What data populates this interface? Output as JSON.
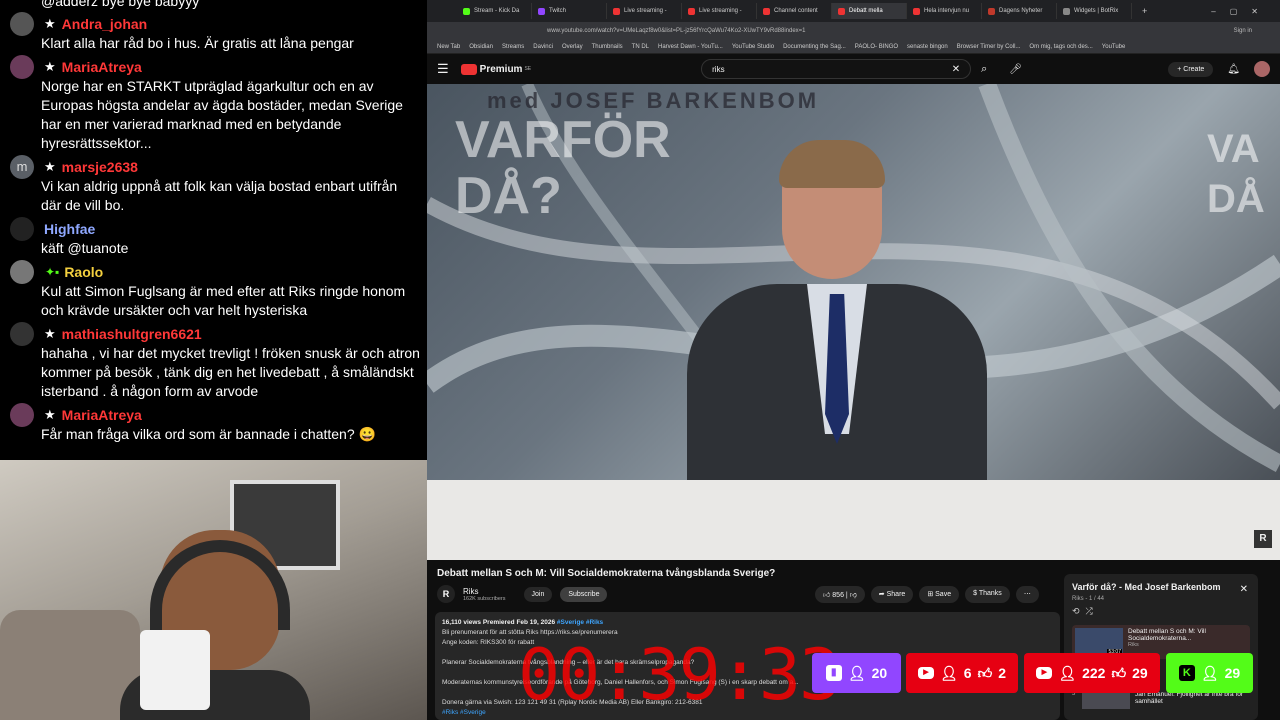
{
  "chat": {
    "messages": [
      {
        "user": "",
        "text": "@adderz bye bye babyyy"
      },
      {
        "user": "Andra_johan",
        "text": "Klart alla har råd bo i hus. Är gratis att låna pengar"
      },
      {
        "user": "MariaAtreya",
        "text": "Norge har en STARKT utpräglad ägarkultur och en av Europas högsta andelar av ägda bostäder, medan Sverige har en mer varierad marknad med en betydande hyresrättssektor..."
      },
      {
        "user": "marsje2638",
        "avatar_letter": "m",
        "text": "Vi kan aldrig uppnå att folk kan välja bostad enbart utifrån där de vill bo."
      },
      {
        "user": "Highfae",
        "text": "käft @tuanote"
      },
      {
        "user": "Raolo",
        "text": "Kul att Simon Fuglsang är med efter att Riks ringde honom och krävde ursäkter och var helt hysteriska"
      },
      {
        "user": "mathiashultgren6621",
        "text": "hahaha , vi har det mycket trevligt ! fröken snusk är och atron kommer på besök , tänk dig en het livedebatt , å småländskt isterband . å någon form av arvode"
      },
      {
        "user": "MariaAtreya",
        "text": "Får man fråga vilka ord som är bannade i chatten? 😀"
      }
    ]
  },
  "browser": {
    "tabs": [
      "Stream - Kick Da",
      "Twitch",
      "Live streaming -",
      "Live streaming -",
      "Channel content",
      "Debatt mella",
      "Hela intervjun nu",
      "Dagens Nyheter",
      "Widgets | BotRix"
    ],
    "url": "www.youtube.com/watch?v=UMeLaqzf8w0&list=PL-jz56fYrcQaWu74Ko2-XUwTY9vRd88index=1",
    "sign_in": "Sign in",
    "bookmarks": [
      "New Tab",
      "Obsidian",
      "Streams",
      "Davinci",
      "Overlay",
      "Thumbnails",
      "TN DL",
      "Harvest Dawn - YouTu...",
      "YouTube Studio",
      "Documenting the Sag...",
      "PAOLO- BINGO",
      "senaste bingon",
      "Browser Timer by Coll...",
      "Om mig, tags och des...",
      "YouTube"
    ]
  },
  "youtube": {
    "logo": "Premium",
    "logo_sup": "SE",
    "search_value": "riks",
    "create_label": "Create",
    "video_overlay_text": "med JOSEF BARKENBOM",
    "video_big_text": "VARFÖR DÅ?",
    "video_big_text_right": "VA DÅ",
    "title": "Debatt mellan S och M: Vill Socialdemokraterna tvångsblanda Sverige?",
    "channel_name": "Riks",
    "subscribers": "162K subscribers",
    "join_label": "Join",
    "subscribe_label": "Subscribe",
    "likes": "856",
    "share_label": "Share",
    "save_label": "Save",
    "thanks_label": "Thanks",
    "description": {
      "meta": "16,110 views  Premiered Feb 19, 2026",
      "hashtags": "#Sverige #Riks",
      "line1": "Bli prenumerant för att stötta Riks https://riks.se/prenumerera",
      "line2": "Ange koden: RIKS300 för rabatt",
      "line3": "Planerar Socialdemokraterna tvångsblandning – eller är det bara skrämselpropaganda?",
      "line4": "Moderaternas kommunstyrelseordförande på Göteborg, Daniel Hallenfors, och Simon Fuglsang (S) i en skarp debatt om a...",
      "line5": "Donera gärna via Swish: 123 121 49 31 (Rplay Nordic Media AB) Eller Bankgiro: 212-6381",
      "line6": "#Riks #Sverige"
    },
    "playlist": {
      "title": "Varför då? - Med Josef Barkenbom",
      "meta": "Riks - 1 / 44",
      "items": [
        {
          "title": "Debatt mellan S och M: Vill Socialdemokraterna...",
          "channel": "Riks",
          "duration": "53:07"
        },
        {
          "title": "Jan Emanuel: Fjollighet är inte bra för samhället",
          "channel": "Riks",
          "index": "3"
        }
      ]
    }
  },
  "overlay": {
    "timer": "00:39:33",
    "stats": [
      {
        "platform": "twitch",
        "viewers": "20",
        "likes": ""
      },
      {
        "platform": "youtube",
        "viewers": "6",
        "likes": "2"
      },
      {
        "platform": "youtube",
        "viewers": "222",
        "likes": "29"
      },
      {
        "platform": "kick",
        "viewers": "29",
        "likes": ""
      }
    ]
  },
  "colors": {
    "twitch": "#9146ff",
    "youtube": "#e60012",
    "kick": "#53fc18",
    "chat_user": "#ff3838",
    "timer": "#ff0000"
  }
}
